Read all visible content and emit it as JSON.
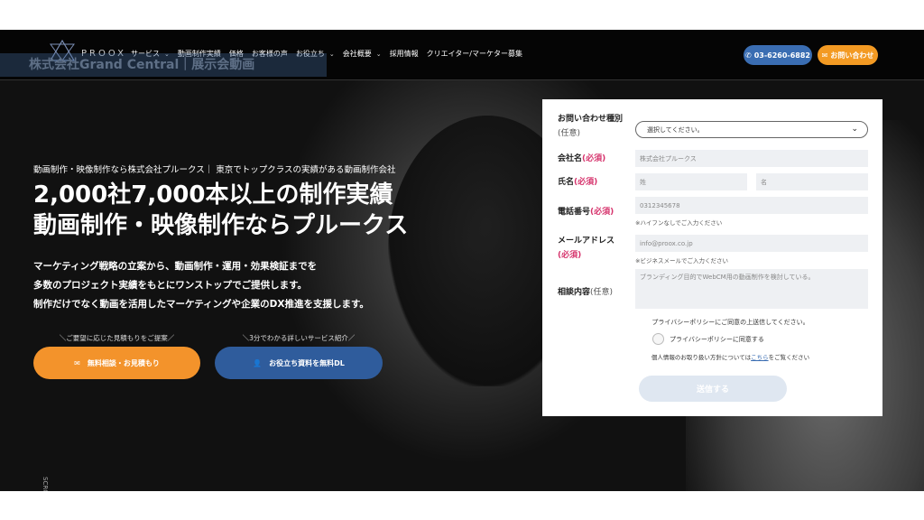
{
  "nav": {
    "logo_text": "PROOX",
    "items": [
      {
        "label": "サービス",
        "dropdown": true
      },
      {
        "label": "動画制作実績",
        "dropdown": false
      },
      {
        "label": "価格",
        "dropdown": false
      },
      {
        "label": "お客様の声",
        "dropdown": false
      },
      {
        "label": "お役立ち",
        "dropdown": true
      },
      {
        "label": "会社概要",
        "dropdown": true
      },
      {
        "label": "採用情報",
        "dropdown": false
      },
      {
        "label": "クリエイター/マーケター募集",
        "dropdown": false
      }
    ],
    "phone_label": "03-6260-6882",
    "contact_label": "お問い合わせ"
  },
  "overlay_title": "株式会社Grand Central｜展示会動画",
  "hero": {
    "tagline": "動画制作・映像制作なら株式会社プルークス｜ 東京でトップクラスの実績がある動画制作会社",
    "headline_line1": "2,000社7,000本以上の制作実績",
    "headline_line2": "動画制作・映像制作ならプルークス",
    "desc_line1": "マーケティング戦略の立案から、動画制作・運用・効果検証までを",
    "desc_line2": "多数のプロジェクト実績をもとにワンストップでご提供します。",
    "desc_line3": "制作だけでなく動画を活用したマーケティングや企業のDX推進を支援します。",
    "cta1_caption": "＼ご要望に応じた見積もりをご提案／",
    "cta1_label": "無料相談・お見積もり",
    "cta2_caption": "＼3分でわかる詳しいサービス紹介／",
    "cta2_label": "お役立ち資料を無料DL",
    "scroll_label": "SCROLL"
  },
  "form": {
    "inquiry_type_label": "お問い合わせ種別",
    "inquiry_type_opt": "(任意)",
    "inquiry_type_value": "選択してください。",
    "company_label": "会社名",
    "company_req": "(必須)",
    "company_placeholder": "株式会社プルークス",
    "name_label": "氏名",
    "name_req": "(必須)",
    "last_name_placeholder": "姓",
    "first_name_placeholder": "名",
    "phone_label": "電話番号",
    "phone_req": "(必須)",
    "phone_placeholder": "0312345678",
    "phone_hint": "※ハイフンなしでご入力ください",
    "email_label": "メールアドレス",
    "email_req": "(必須)",
    "email_placeholder": "info@proox.co.jp",
    "email_hint": "※ビジネスメールでご入力ください",
    "message_label": "相談内容",
    "message_opt": "(任意)",
    "message_placeholder": "ブランディング目的でWebCM用の動画制作を検討している。",
    "privacy_note": "プライバシーポリシーにご同意の上送信してください。",
    "agree_label": "プライバシーポリシーに同意する",
    "policy_prefix": "個人情報のお取り扱い方針については",
    "policy_link": "こちら",
    "policy_suffix": "をご覧ください",
    "submit_label": "送信する"
  },
  "colors": {
    "orange": "#f3932b",
    "blue": "#2f5c9c",
    "required": "#d6336c"
  }
}
